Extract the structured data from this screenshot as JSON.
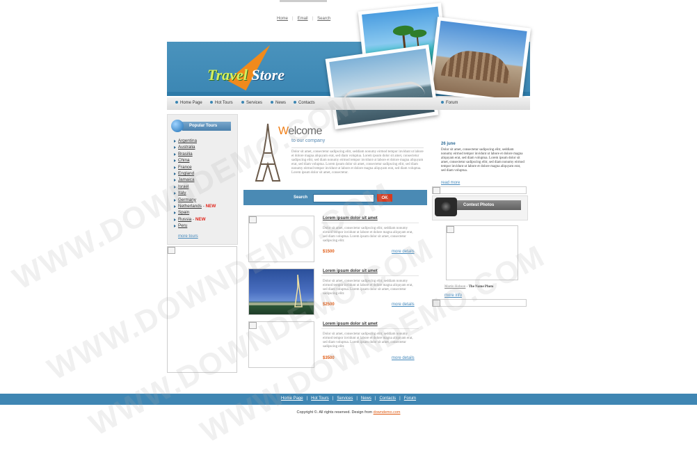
{
  "top_links": [
    "Home",
    "Email",
    "Search"
  ],
  "logo": {
    "part1": "Travel",
    "part2": "Store"
  },
  "nav": {
    "items": [
      "Home Page",
      "Hot Tours",
      "Services",
      "News",
      "Contacts"
    ],
    "forum": "Forum"
  },
  "sidebar": {
    "title": "Popular Tours",
    "countries": [
      {
        "name": "Argentina",
        "badge": ""
      },
      {
        "name": "Australia",
        "badge": ""
      },
      {
        "name": "Brasilia",
        "badge": ""
      },
      {
        "name": "China",
        "badge": ""
      },
      {
        "name": "France",
        "badge": ""
      },
      {
        "name": "England",
        "badge": ""
      },
      {
        "name": "Jamaica",
        "badge": ""
      },
      {
        "name": "Israel",
        "badge": ""
      },
      {
        "name": "Italy",
        "badge": ""
      },
      {
        "name": "Germany",
        "badge": ""
      },
      {
        "name": "Netherlands",
        "badge": "NEW"
      },
      {
        "name": "Spain",
        "badge": ""
      },
      {
        "name": "Russia",
        "badge": "NEW"
      },
      {
        "name": "Peru",
        "badge": ""
      }
    ],
    "more_link": "more tours"
  },
  "welcome": {
    "title_first": "W",
    "title_rest": "elcome",
    "subtitle": "to our company",
    "text": "Dolor sit amet, consectetur sadipscing elitr, seddiam nonumy eirmod tempor invidunt ut labore et dolore magna aliquyam erat, sed diam voluptua. Lorem ipsum dolor sit amet, consectetur sadipscing elitr, sed diam nonumy eirmod tempor invidunt ut labore et dolore magna aliquyam erat, sed diam voluptua. Lorem ipsum dolor sit amet, consectetur sadipscing elitr, sed diam nonumy eirmod tempor invidunt ut labore et dolore magna aliquyam erat, sed diam voluptua. Lorem ipsum dolor sit amet, consectetur."
  },
  "search": {
    "label": "Search",
    "value": "",
    "button": "OK"
  },
  "tours": [
    {
      "title": "Lorem ipsum dolor sit amet",
      "text": "Dolor sit amet, consectetur sadipscing elitr, seddiam nonumy eirmod tempor invidunt ut labore et dolore magna aliquyam erat, sed diam voluptua. Lorem ipsum dolor sit amet, consectetur sadipscing elitr.",
      "price": "$1500",
      "more": "more details"
    },
    {
      "title": "Lorem ipsum dolor sit amet",
      "text": "Dolor sit amet, consectetur sadipscing elitr, seddiam nonumy eirmod tempor invidunt ut labore et dolore magna aliquyam erat, sed diam voluptua. Lorem ipsum dolor sit amet, consectetur sadipscing elitr.",
      "price": "$2500",
      "more": "more details"
    },
    {
      "title": "Lorem ipsum dolor sit amet",
      "text": "Dolor sit amet, consectetur sadipscing elitr, seddiam nonumy eirmod tempor invidunt ut labore et dolore magna aliquyam erat, sed diam voluptua. Lorem ipsum dolor sit amet, consectetur sadipscing elitr.",
      "price": "$3500",
      "more": "more details"
    }
  ],
  "news": {
    "date": "26 june",
    "text": "Dolor sit amet, consectetur sadipscing elitr, seddiam nonumy eirmod tempor invidunt ut labore et dolore magna aliquyam erat, sed diam voluptua. Lorem ipsum dolor sit amet, consectetur sadipscing elitr, sed diam nonumy eirmod tempor invidunt ut labore et dolore magna aliquyam erat, sed diam voluptua.",
    "more": "read more"
  },
  "contest": {
    "title": "Contest Photos",
    "author": "Martin Hobson",
    "separator": " - ",
    "photo_name": "The Name Photo",
    "more": "more info"
  },
  "footer": {
    "links": [
      "Home Page",
      "Hot Tours",
      "Services",
      "News",
      "Contacts",
      "Forum"
    ],
    "copyright": "Copyright ©. All rights reserved. Design from",
    "design_link": "downdemo.com"
  },
  "watermark": "WWW.DOWNDEMO.COM",
  "colors": {
    "header_blue": "#3b86b3",
    "accent_orange": "#f07c12",
    "new_red": "#e0251b"
  }
}
